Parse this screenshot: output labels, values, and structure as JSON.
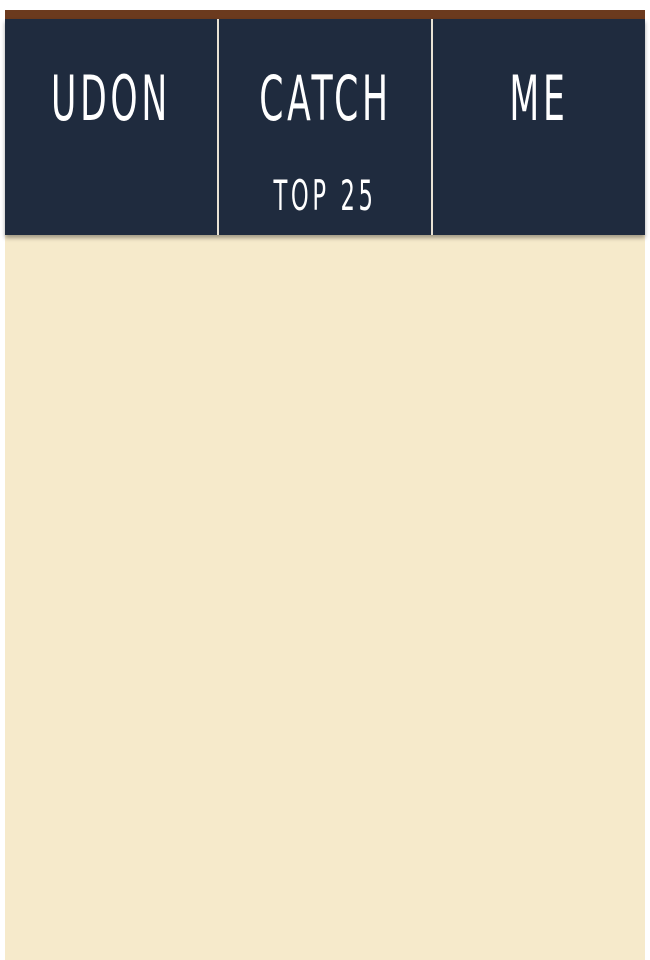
{
  "nav": {
    "tiles": [
      {
        "title": "UDON",
        "subtitle": ""
      },
      {
        "title": "CATCH",
        "subtitle": "TOP 25"
      },
      {
        "title": "ME",
        "subtitle": ""
      }
    ]
  },
  "colors": {
    "top_strip": "#6b3a1e",
    "tile_background": "#1f2b3e",
    "tile_text": "#ffffff",
    "content_background": "#f6eacb",
    "tile_divider": "#e8e2d4"
  }
}
